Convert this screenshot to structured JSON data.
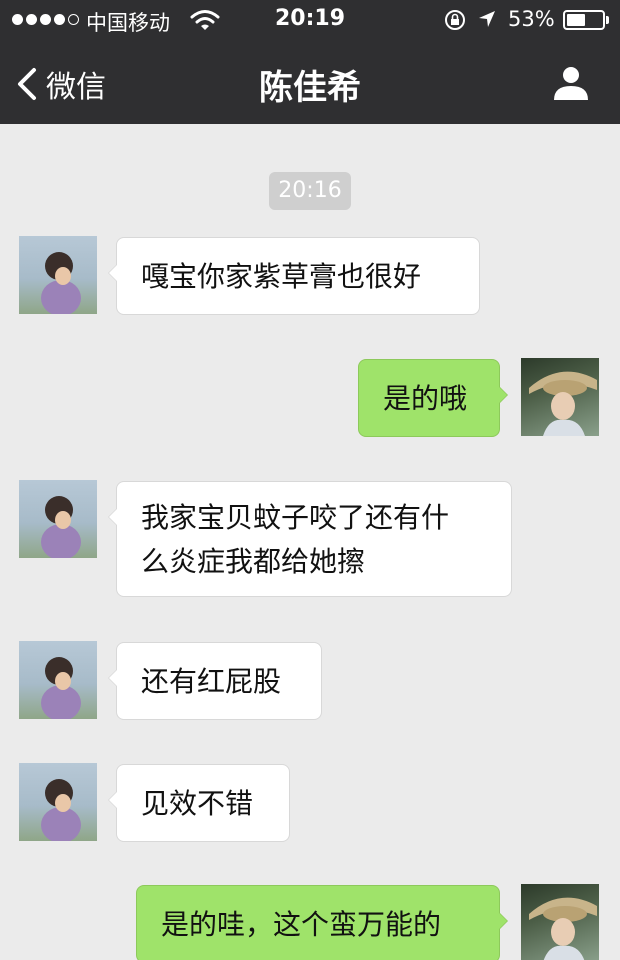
{
  "status_bar": {
    "carrier": "中国移动",
    "time": "20:19",
    "battery_percent": "53%",
    "battery_level": 0.53,
    "signal_bars_filled": 4,
    "signal_bars_total": 5,
    "icons": [
      "wifi-icon",
      "rotation-lock-icon",
      "location-icon",
      "battery-icon"
    ]
  },
  "nav": {
    "back_label": "微信",
    "title": "陈佳希",
    "icons": [
      "back-chevron-icon",
      "person-icon"
    ]
  },
  "chat": {
    "timestamp": "20:16",
    "messages": [
      {
        "side": "left",
        "text": "嘎宝你家紫草膏也很好"
      },
      {
        "side": "right",
        "text": "是的哦"
      },
      {
        "side": "left",
        "text": "我家宝贝蚊子咬了还有什\n么炎症我都给她擦"
      },
      {
        "side": "left",
        "text": "还有红屁股"
      },
      {
        "side": "left",
        "text": "见效不错"
      },
      {
        "side": "right",
        "text": "是的哇，这个蛮万能的"
      }
    ]
  },
  "colors": {
    "nav_background": "#2f2f31",
    "chat_background": "#ebebeb",
    "outgoing_bubble": "#9fe36a",
    "incoming_bubble": "#ffffff",
    "timestamp_background": "#cfcfcf"
  }
}
